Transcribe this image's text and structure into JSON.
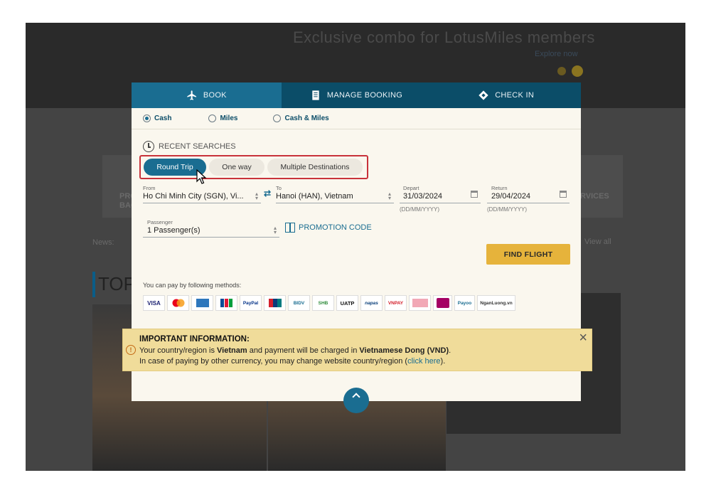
{
  "background": {
    "headline": "Exclusive combo for LotusMiles members",
    "sub_link": "Explore now",
    "side_left": "PRO\nBAG",
    "side_right": "RVICES",
    "news_label": "News:",
    "view_all": "View all",
    "top_label": "TOP"
  },
  "tabs": [
    {
      "label": "BOOK",
      "icon": "plane-icon",
      "active": true
    },
    {
      "label": "MANAGE BOOKING",
      "icon": "document-icon",
      "active": false
    },
    {
      "label": "CHECK IN",
      "icon": "ticket-icon",
      "active": false
    }
  ],
  "payment_types": [
    {
      "label": "Cash",
      "selected": true
    },
    {
      "label": "Miles",
      "selected": false
    },
    {
      "label": "Cash & Miles",
      "selected": false
    }
  ],
  "recent_searches": "RECENT SEARCHES",
  "trip_types": [
    {
      "label": "Round Trip",
      "active": true
    },
    {
      "label": "One way",
      "active": false
    },
    {
      "label": "Multiple Destinations",
      "active": false
    }
  ],
  "from": {
    "label": "From",
    "value": "Ho Chi Minh City (SGN), Vi..."
  },
  "to": {
    "label": "To",
    "value": "Hanoi (HAN), Vietnam"
  },
  "depart": {
    "label": "Depart",
    "value": "31/03/2024",
    "format": "(DD/MM/YYYY)"
  },
  "return": {
    "label": "Return",
    "value": "29/04/2024",
    "format": "(DD/MM/YYYY)"
  },
  "passenger": {
    "label": "Passenger",
    "value": "1 Passenger(s)"
  },
  "promotion_code": "PROMOTION CODE",
  "find_flight": "FIND FLIGHT",
  "methods_label": "You can pay by following methods:",
  "payment_methods": [
    "VISA",
    "Mastercard",
    "AMEX",
    "JCB",
    "PayPal",
    "UnionPay",
    "BIDV",
    "SHB",
    "UATP",
    "napas",
    "VNPAY",
    "Vietcombank",
    "MoMo",
    "Payoo",
    "NganLuong.vn"
  ],
  "notice": {
    "title": "IMPORTANT INFORMATION:",
    "line1_prefix": "Your country/region is ",
    "country": "Vietnam",
    "line1_mid": " and payment will be charged in ",
    "currency": "Vietnamese Dong (VND)",
    "line1_end": ".",
    "line2_prefix": "In case of paying by other currency, you may change website country/region (",
    "link": "click here",
    "line2_end": ")."
  },
  "colors": {
    "brand_dark": "#0b4d68",
    "brand": "#1a6d91",
    "accent": "#e6b33b",
    "notice_bg": "#f0dc9a",
    "highlight_border": "#c8323a"
  }
}
